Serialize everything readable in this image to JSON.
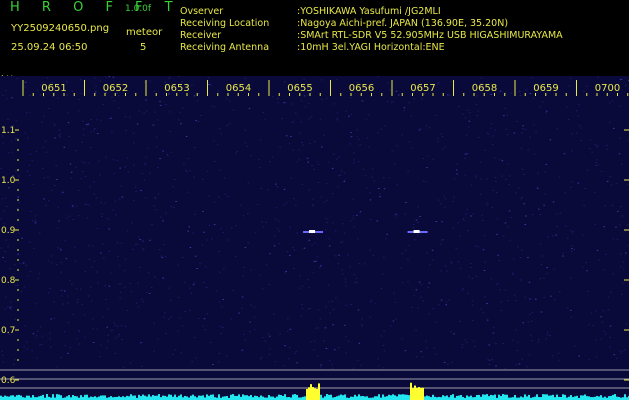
{
  "header": {
    "app_title": "H R O F F T",
    "version": "1.0.0f",
    "filename": "YY2509240650.png",
    "timestamp": "25.09.24 06:50",
    "meteor_label": "meteor",
    "meteor_count": "5"
  },
  "station_info": [
    {
      "label": "Ovserver",
      "value": ":YOSHIKAWA Yasufumi /JG2MLI"
    },
    {
      "label": "Receiving Location",
      "value": ":Nagoya Aichi-pref. JAPAN (136.90E, 35.20N)"
    },
    {
      "label": "Receiver",
      "value": ":SMArt RTL-SDR V5 52.905MHz USB HIGASHIMURAYAMA"
    },
    {
      "label": "Receiving Antenna",
      "value": ":10mH 3el.YAGI Horizontal:ENE"
    }
  ],
  "spectrogram": {
    "y_unit": "kHz",
    "time_ticks": [
      "0651",
      "0652",
      "0653",
      "0654",
      "0655",
      "0656",
      "0657",
      "0658",
      "0659",
      "0700"
    ],
    "freq_ticks": [
      "1.1",
      "1.0",
      "0.9",
      "0.8",
      "0.7",
      "0.6"
    ],
    "freq_range": [
      0.58,
      1.18
    ],
    "background_color": "#0a0a3a",
    "echo_color": "#ffffff",
    "axis_color": "#e8e84a",
    "level_color": "#22e6f0",
    "meteor_events": [
      {
        "time": "0655.7",
        "freq": 0.9
      },
      {
        "time": "0657.4",
        "freq": 0.9
      }
    ]
  }
}
